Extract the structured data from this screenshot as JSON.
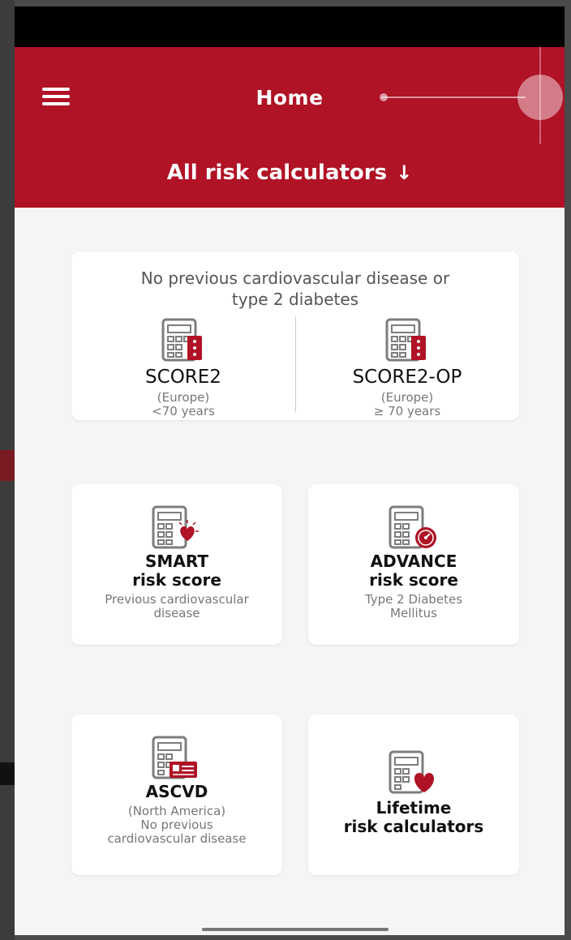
{
  "app": {
    "title": "Home",
    "subheader_label": "All risk calculators",
    "subheader_icon": "arrow-down-icon",
    "menu_icon": "menu-icon",
    "brand_color": "#b01226"
  },
  "group": {
    "heading_line1": "No previous cardiovascular disease or",
    "heading_line2": "type 2 diabetes",
    "items": [
      {
        "name": "SCORE2",
        "line1": "(Europe)",
        "line2": "<70 years",
        "icon": "calculator-chart-icon"
      },
      {
        "name": "SCORE2-OP",
        "line1": "(Europe)",
        "line2": "≥ 70 years",
        "icon": "calculator-chart-icon"
      }
    ]
  },
  "cards": [
    {
      "name_line1": "SMART",
      "name_line2": "risk score",
      "sub_line1": "Previous cardiovascular",
      "sub_line2": "disease",
      "icon": "calculator-heart-alert-icon"
    },
    {
      "name_line1": "ADVANCE",
      "name_line2": "risk score",
      "sub_line1": "Type 2 Diabetes",
      "sub_line2": "Mellitus",
      "icon": "calculator-gauge-icon"
    },
    {
      "name_line1": "ASCVD",
      "sub_line1": "(North America)",
      "sub_line2": "No previous",
      "sub_line3": "cardiovascular disease",
      "icon": "calculator-id-card-icon"
    },
    {
      "name_line1": "Lifetime",
      "name_line2": "risk calculators",
      "icon": "calculator-heart-icon"
    }
  ]
}
